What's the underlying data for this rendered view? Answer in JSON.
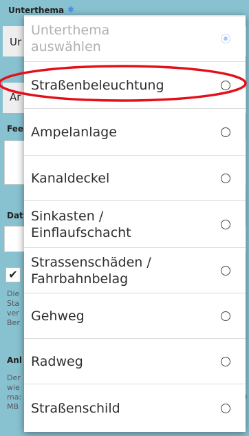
{
  "form": {
    "unterthema_label": "Unterthema",
    "unterthema_value_partial": "Ur",
    "anliegen_value_partial": "Ar",
    "feedback_label_partial": "Fee",
    "datum_label_partial": "Dat",
    "hint_lines_partial": [
      "Die",
      "Sta",
      "ver",
      "Ber"
    ],
    "anh_label_partial": "Anl",
    "anh_lines_left": [
      "Der",
      "wie",
      "ma:",
      "MB"
    ],
    "anh_right_partial": [
      "n,",
      "10"
    ]
  },
  "dialog": {
    "options": [
      {
        "label": "Unterthema\nauswählen",
        "selected": true,
        "disabled": true
      },
      {
        "label": "Straßenbeleuchtung",
        "selected": false,
        "disabled": false
      },
      {
        "label": "Ampelanlage",
        "selected": false,
        "disabled": false
      },
      {
        "label": "Kanaldeckel",
        "selected": false,
        "disabled": false
      },
      {
        "label": "Sinkasten /\nEinflaufschacht",
        "selected": false,
        "disabled": false
      },
      {
        "label": "Strassenschäden /\nFahrbahnbelag",
        "selected": false,
        "disabled": false
      },
      {
        "label": "Gehweg",
        "selected": false,
        "disabled": false
      },
      {
        "label": "Radweg",
        "selected": false,
        "disabled": false
      },
      {
        "label": "Straßenschild",
        "selected": false,
        "disabled": false
      }
    ]
  },
  "annotation": {
    "highlight_color": "#e3101a",
    "highlighted_option": "Straßenbeleuchtung"
  },
  "colors": {
    "backdrop": "#88c2d1",
    "dialog_background": "#ffffff",
    "selected_radio": "#a9c7f2"
  }
}
